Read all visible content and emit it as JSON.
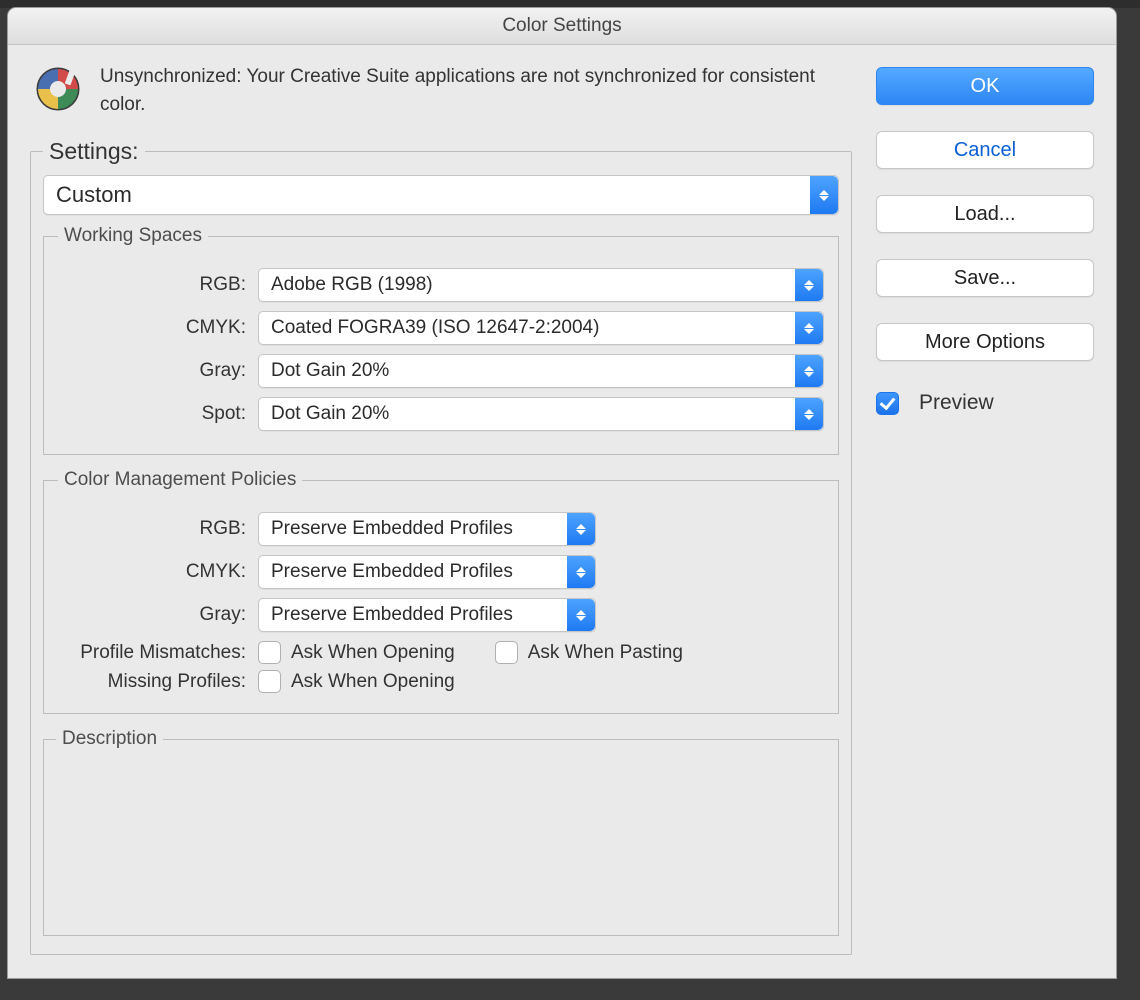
{
  "titlebar": "Color Settings",
  "sync_message": "Unsynchronized: Your Creative Suite applications are not synchronized for consistent color.",
  "settings": {
    "label": "Settings:",
    "value": "Custom"
  },
  "working_spaces": {
    "legend": "Working Spaces",
    "rgb": {
      "label": "RGB:",
      "value": "Adobe RGB (1998)"
    },
    "cmyk": {
      "label": "CMYK:",
      "value": "Coated FOGRA39 (ISO 12647-2:2004)"
    },
    "gray": {
      "label": "Gray:",
      "value": "Dot Gain 20%"
    },
    "spot": {
      "label": "Spot:",
      "value": "Dot Gain 20%"
    }
  },
  "policies": {
    "legend": "Color Management Policies",
    "rgb": {
      "label": "RGB:",
      "value": "Preserve Embedded Profiles"
    },
    "cmyk": {
      "label": "CMYK:",
      "value": "Preserve Embedded Profiles"
    },
    "gray": {
      "label": "Gray:",
      "value": "Preserve Embedded Profiles"
    },
    "mismatch_label": "Profile Mismatches:",
    "mismatch_open": "Ask When Opening",
    "mismatch_paste": "Ask When Pasting",
    "missing_label": "Missing Profiles:",
    "missing_open": "Ask When Opening"
  },
  "description": {
    "legend": "Description"
  },
  "buttons": {
    "ok": "OK",
    "cancel": "Cancel",
    "load": "Load...",
    "save": "Save...",
    "more": "More Options"
  },
  "preview": {
    "label": "Preview",
    "checked": true
  }
}
